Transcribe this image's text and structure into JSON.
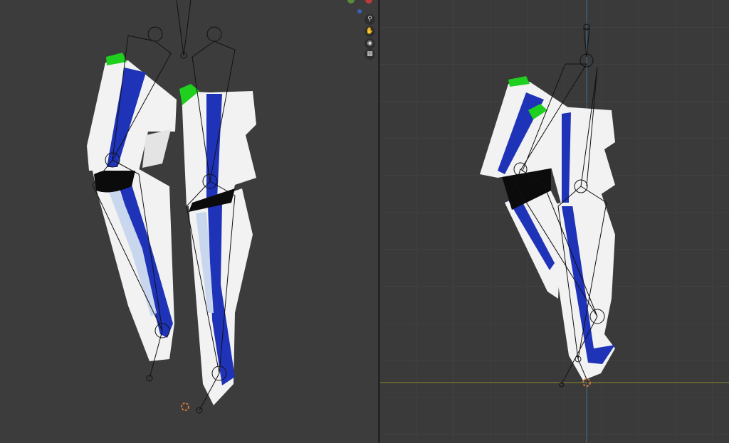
{
  "app": "Blender",
  "viewports": [
    {
      "name": "perspective-viewport",
      "grid": false
    },
    {
      "name": "orthographic-viewport",
      "grid": true
    }
  ],
  "navigation_gizmo": {
    "icons": [
      "zoom-icon",
      "hand-pan-icon",
      "camera-icon",
      "grid-ortho-icon"
    ]
  },
  "colors": {
    "armor_white": "#f2f2f2",
    "stripe_blue": "#1f33b8",
    "stripe_light": "#c8d6ee",
    "accent_green": "#1fd01f",
    "bone_line": "#111111",
    "x_axis": "#8a8a2a",
    "z_axis": "#3d6f8f"
  }
}
